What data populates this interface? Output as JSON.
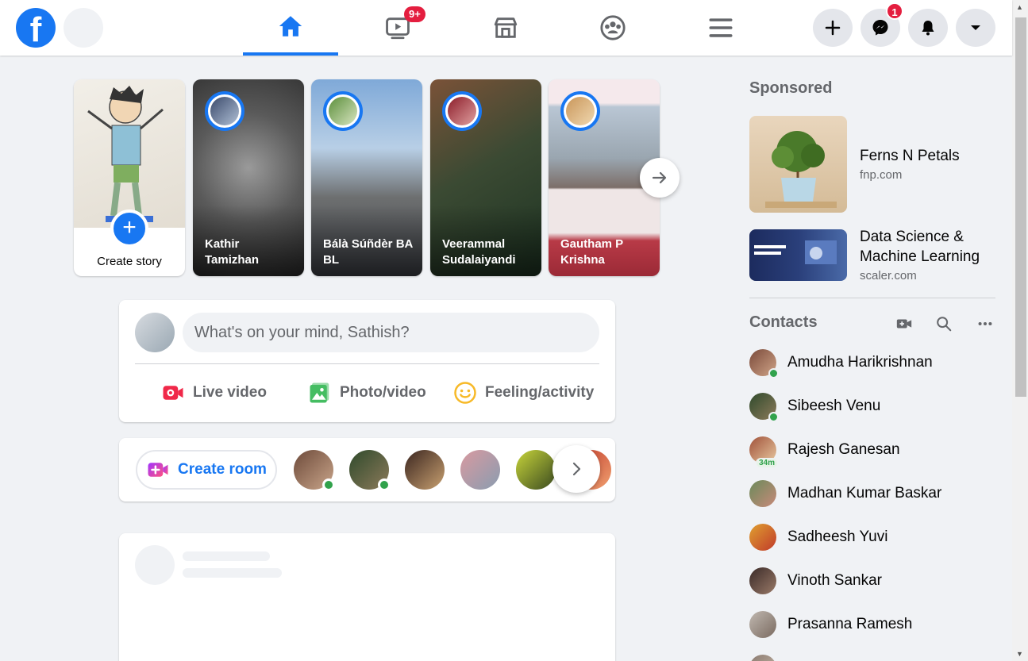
{
  "header": {
    "logo": "f",
    "nav_tabs": [
      {
        "name": "home",
        "active": true
      },
      {
        "name": "watch",
        "badge": "9+"
      },
      {
        "name": "marketplace"
      },
      {
        "name": "groups"
      },
      {
        "name": "menu"
      }
    ],
    "actions": [
      {
        "name": "create"
      },
      {
        "name": "messenger",
        "badge": "1"
      },
      {
        "name": "notifications"
      },
      {
        "name": "account"
      }
    ]
  },
  "stories": {
    "create_label": "Create story",
    "items": [
      {
        "name": "Kathir Tamizhan"
      },
      {
        "name": "Bálà Súñdèr BA BL"
      },
      {
        "name": "Veerammal Sudalaiyandi"
      },
      {
        "name": "Gautham P Krishna"
      }
    ]
  },
  "composer": {
    "placeholder": "What's on your mind, Sathish?",
    "actions": [
      "Live video",
      "Photo/video",
      "Feeling/activity"
    ]
  },
  "rooms": {
    "create_label": "Create room"
  },
  "sponsored": {
    "heading": "Sponsored",
    "ads": [
      {
        "title": "Ferns N Petals",
        "url": "fnp.com"
      },
      {
        "title": "Data Science & Machine Learning",
        "url": "scaler.com"
      }
    ]
  },
  "contacts": {
    "heading": "Contacts",
    "items": [
      {
        "name": "Amudha Harikrishnan",
        "online": true
      },
      {
        "name": "Sibeesh Venu",
        "online": true
      },
      {
        "name": "Rajesh Ganesan",
        "last_active": "34m"
      },
      {
        "name": "Madhan Kumar Baskar"
      },
      {
        "name": "Sadheesh Yuvi"
      },
      {
        "name": "Vinoth Sankar"
      },
      {
        "name": "Prasanna Ramesh"
      }
    ]
  },
  "colors": {
    "brand": "#1877f2",
    "badge": "#e41e3f",
    "online": "#31a24c",
    "background": "#f0f2f5"
  }
}
